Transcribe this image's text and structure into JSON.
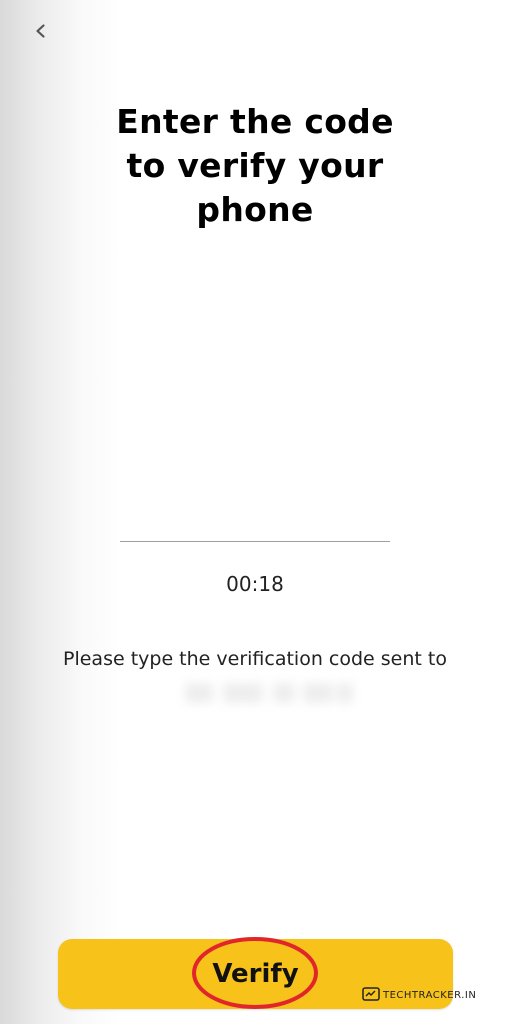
{
  "header": {
    "back_icon": "chevron-left-icon"
  },
  "title": {
    "lines": [
      "Enter the code",
      "to verify your",
      "phone"
    ]
  },
  "code_input": {
    "value": ""
  },
  "timer": {
    "text": "00:18"
  },
  "instruction": {
    "text": "Please type the verification code sent to"
  },
  "verify_button": {
    "label": "Verify"
  },
  "watermark": {
    "icon": "tracker-logo-icon",
    "text": "TECHTRACKER.IN"
  },
  "colors": {
    "accent": "#f7c21a",
    "highlight": "#e1262b",
    "text": "#111111",
    "underline": "#9e9e9e"
  }
}
